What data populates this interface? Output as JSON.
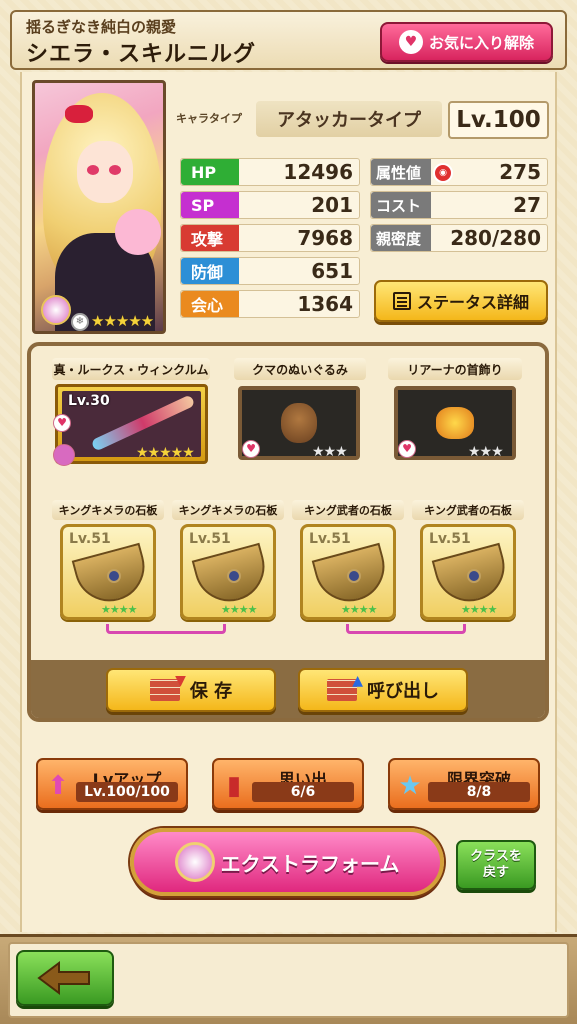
{
  "header": {
    "subtitle": "揺るぎなき純白の親愛",
    "name": "シエラ・スキルニルグ",
    "favorite_label": "お気に入り解除"
  },
  "portrait": {
    "rarity_stars": "★★★★★"
  },
  "char_type": {
    "label": "キャラタイプ",
    "value": "アタッカータイプ",
    "level": "Lv.100"
  },
  "stats_left": [
    {
      "label": "HP",
      "value": "12496",
      "color": "#2fae35"
    },
    {
      "label": "SP",
      "value": "201",
      "color": "#c52fd0"
    },
    {
      "label": "攻撃",
      "value": "7968",
      "color": "#d83b32"
    },
    {
      "label": "防御",
      "value": "651",
      "color": "#2d8fd6"
    },
    {
      "label": "会心",
      "value": "1364",
      "color": "#ea8a1e"
    }
  ],
  "stats_right": [
    {
      "label": "属性値",
      "value": "275"
    },
    {
      "label": "コスト",
      "value": "27"
    },
    {
      "label": "親密度",
      "value": "280/280"
    }
  ],
  "status_button": "ステータス詳細",
  "equipment": {
    "weapon": {
      "title": "真・ルークス・ウィンクルム",
      "level": "Lv.30",
      "stars": "★★★★★"
    },
    "accessories": [
      {
        "title": "クマのぬいぐるみ",
        "stars": "★★★"
      },
      {
        "title": "リアーナの首飾り",
        "stars": "★★★"
      }
    ],
    "stones": [
      {
        "title": "キングキメラの石板",
        "level": "Lv.51",
        "stars": "★★★★"
      },
      {
        "title": "キングキメラの石板",
        "level": "Lv.51",
        "stars": "★★★★"
      },
      {
        "title": "キング武者の石板",
        "level": "Lv.51",
        "stars": "★★★★"
      },
      {
        "title": "キング武者の石板",
        "level": "Lv.51",
        "stars": "★★★★"
      }
    ],
    "save_label": "保 存",
    "load_label": "呼び出し"
  },
  "bottom": {
    "lvup_title": "Lvアップ",
    "lvup_value": "Lv.100/100",
    "memory_title": "思い出",
    "memory_value": "6/6",
    "limit_title": "限界突破",
    "limit_value": "8/8",
    "extra_form": "エクストラフォーム",
    "class_back": "クラスを\n戻す"
  }
}
